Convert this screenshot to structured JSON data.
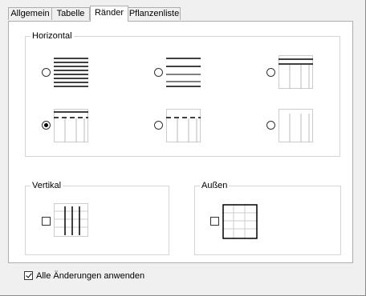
{
  "tabs": [
    {
      "label": "Allgemein",
      "active": false
    },
    {
      "label": "Tabelle",
      "active": false
    },
    {
      "label": "Ränder",
      "active": true
    },
    {
      "label": "Pflanzenliste",
      "active": false
    }
  ],
  "horizontal": {
    "title": "Horizontal",
    "options": [
      {
        "id": "all-lines",
        "selected": false
      },
      {
        "id": "outer-inner-bold",
        "selected": false
      },
      {
        "id": "top-double-with-verticals",
        "selected": false
      },
      {
        "id": "top-line-dashed-verticals",
        "selected": true
      },
      {
        "id": "dashed-top-verticals",
        "selected": false
      },
      {
        "id": "verticals-only",
        "selected": false
      }
    ]
  },
  "vertical": {
    "title": "Vertikal",
    "checked": false
  },
  "outer": {
    "title": "Außen",
    "checked": false
  },
  "apply_all": {
    "label": "Alle Änderungen anwenden",
    "checked": true
  }
}
